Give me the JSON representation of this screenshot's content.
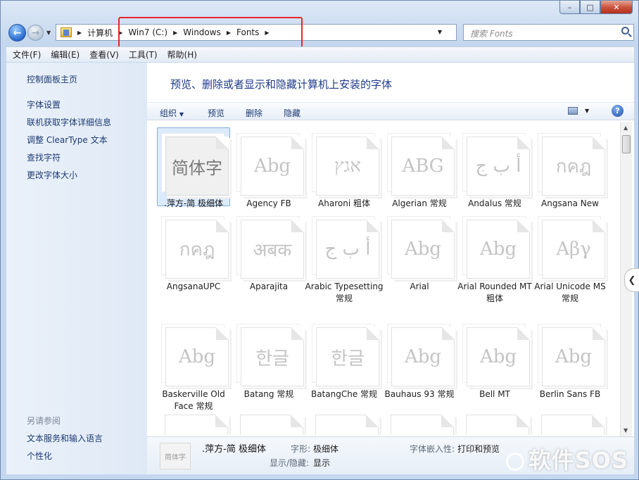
{
  "window": {
    "caption_buttons": [
      "minimize",
      "maximize",
      "close"
    ]
  },
  "nav": {
    "address": [
      "计算机",
      "Win7 (C:)",
      "Windows",
      "Fonts"
    ],
    "search_placeholder": "搜索 Fonts"
  },
  "menubar": {
    "items": [
      "文件(F)",
      "编辑(E)",
      "查看(V)",
      "工具(T)",
      "帮助(H)"
    ]
  },
  "sidebar": {
    "home": "控制面板主页",
    "links": [
      "字体设置",
      "联机获取字体详细信息",
      "调整 ClearType 文本",
      "查找字符",
      "更改字体大小"
    ],
    "see_also_title": "另请参阅",
    "see_also": [
      "文本服务和输入语言",
      "个性化"
    ]
  },
  "main": {
    "heading": "预览、删除或者显示和隐藏计算机上安装的字体",
    "toolbar": {
      "organize": "组织",
      "preview": "预览",
      "delete": "删除",
      "hide": "隐藏"
    }
  },
  "fonts": [
    {
      "name": ".萍方-简 极细体",
      "sample": "简体字",
      "selected": true
    },
    {
      "name": "Agency FB",
      "sample": "Abg"
    },
    {
      "name": "Aharoni 粗体",
      "sample": "אגץ"
    },
    {
      "name": "Algerian 常规",
      "sample": "ABG"
    },
    {
      "name": "Andalus 常规",
      "sample": "أ ب ج"
    },
    {
      "name": "Angsana New",
      "sample": "กคฎ"
    },
    {
      "name": "AngsanaUPC",
      "sample": "กคฎ"
    },
    {
      "name": "Aparajita",
      "sample": "अबक"
    },
    {
      "name": "Arabic Typesetting 常规",
      "sample": "أ ب ج"
    },
    {
      "name": "Arial",
      "sample": "Abg"
    },
    {
      "name": "Arial Rounded MT 粗体",
      "sample": "Abg"
    },
    {
      "name": "Arial Unicode MS 常规",
      "sample": "Αβγ"
    },
    {
      "name": "Baskerville Old Face 常规",
      "sample": "Abg"
    },
    {
      "name": "Batang 常规",
      "sample": "한글"
    },
    {
      "name": "BatangChe 常规",
      "sample": "한글"
    },
    {
      "name": "Bauhaus 93 常规",
      "sample": "Abg"
    },
    {
      "name": "Bell MT",
      "sample": "Abg"
    },
    {
      "name": "Berlin Sans FB",
      "sample": "Abg"
    }
  ],
  "details": {
    "thumb": "简体字",
    "name": ".萍方-简 极细体",
    "style_label": "字形:",
    "style_value": "极细体",
    "show_hide_label": "显示/隐藏:",
    "show_hide_value": "显示",
    "embed_label": "字体嵌入性:",
    "embed_value": "打印和预览"
  },
  "watermark": "软件SOS"
}
